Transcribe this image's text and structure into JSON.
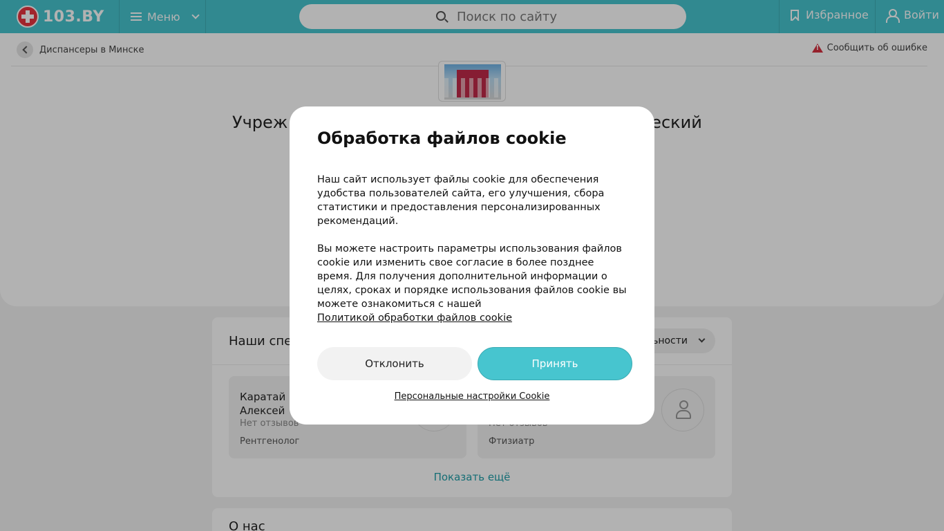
{
  "header": {
    "logo_text": "103.BY",
    "menu_label": "Меню",
    "search_placeholder": "Поиск по сайту",
    "favorites_label": "Избранное",
    "login_label": "Войти"
  },
  "breadcrumb": {
    "label": "Диспансеры в Минске"
  },
  "report_error_label": "Сообщить об ошибке",
  "page": {
    "title_left": "Учреж",
    "title_right": "ческий"
  },
  "specialists": {
    "section_title": "Наши спе",
    "filter_label": "ьности",
    "doctors": [
      {
        "name_line1": "Каратай",
        "name_line2": "Алексей",
        "reviews": "Нет отзывов",
        "specialty": "Рентгенолог"
      },
      {
        "name_line1": "",
        "name_line2": "",
        "reviews": "Нет отзывов",
        "specialty": "Фтизиатр"
      }
    ],
    "show_more": "Показать ещё"
  },
  "about": {
    "title": "О нас"
  },
  "cookie_modal": {
    "title": "Обработка файлов cookie",
    "paragraph1": "Наш сайт использует файлы cookie для обеспечения удобства пользователей сайта, его улучшения, сбора статистики и предоставления персонализированных рекомендаций.",
    "paragraph2": "Вы можете настроить параметры использования файлов cookie или изменить свое согласие в более позднее время. Для получения дополнительной информации о целях, сроках и порядке использования файлов cookie вы можете ознакомиться с нашей",
    "policy_link": "Политикой обработки файлов cookie",
    "decline_label": "Отклонить",
    "accept_label": "Принять",
    "personal_settings_link": "Персональные настройки Cookie"
  },
  "colors": {
    "brand": "#47c5cf",
    "logo_red": "#e8343f",
    "link": "#1f9ea8"
  }
}
